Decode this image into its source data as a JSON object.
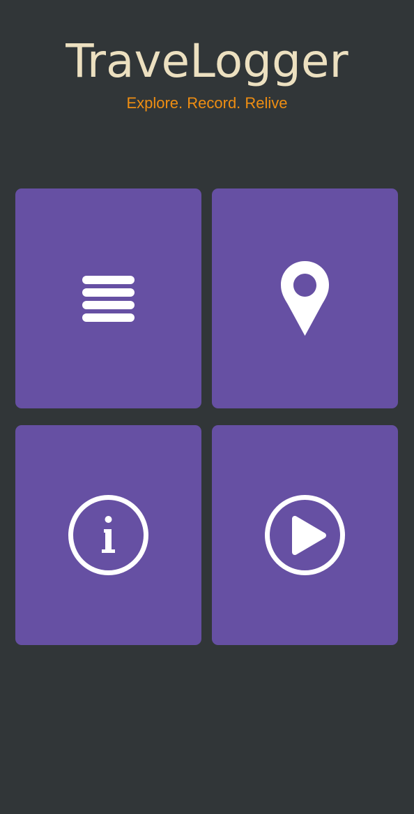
{
  "app": {
    "title": "TraveLogger",
    "tagline": "Explore. Record. Relive"
  },
  "tiles": [
    {
      "id": "menu",
      "icon": "menu-lines-icon"
    },
    {
      "id": "map",
      "icon": "map-pin-icon"
    },
    {
      "id": "info",
      "icon": "info-icon"
    },
    {
      "id": "play",
      "icon": "play-icon"
    }
  ],
  "colors": {
    "background": "#313638",
    "tile": "#6650a3",
    "title": "#ece0c0",
    "tagline": "#ef8e12",
    "icon": "#ffffff"
  }
}
